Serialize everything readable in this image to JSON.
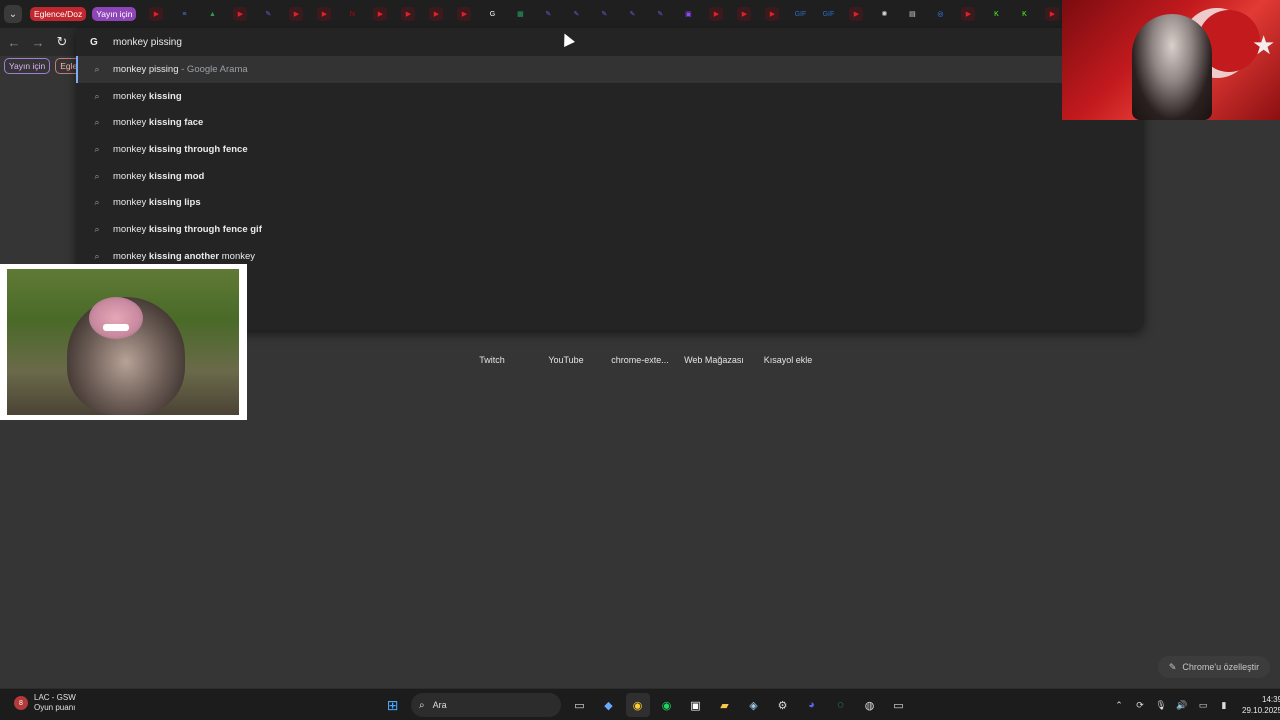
{
  "tabstrip": {
    "menu_icon": "chevron-down-icon",
    "groups": [
      {
        "label": "Eglence/Doz",
        "color": "#c2262e"
      },
      {
        "label": "Yayın için",
        "color": "#8e45b8"
      }
    ],
    "favicons": [
      {
        "icon": "youtube-icon",
        "color": "#e0202a"
      },
      {
        "icon": "docs-icon",
        "color": "#4a7ee0"
      },
      {
        "icon": "drive-icon",
        "color": "#2f9f4e"
      },
      {
        "icon": "youtube-icon",
        "color": "#e0202a"
      },
      {
        "icon": "quill-icon",
        "color": "#6b5bd6"
      },
      {
        "icon": "youtube-icon",
        "color": "#e0202a"
      },
      {
        "icon": "youtube-icon",
        "color": "#e0202a"
      },
      {
        "icon": "netflix-icon",
        "color": "#b00710"
      },
      {
        "icon": "youtube-icon",
        "color": "#e0202a"
      },
      {
        "icon": "youtube-icon",
        "color": "#e0202a"
      },
      {
        "icon": "youtube-icon",
        "color": "#e0202a"
      },
      {
        "icon": "youtube-icon",
        "color": "#e0202a"
      },
      {
        "icon": "google-icon",
        "color": "#ffffff"
      },
      {
        "icon": "sheets-icon",
        "color": "#20a463"
      },
      {
        "icon": "quill-icon",
        "color": "#6b5bd6"
      },
      {
        "icon": "quill-icon",
        "color": "#6b5bd6"
      },
      {
        "icon": "quill-icon",
        "color": "#6b5bd6"
      },
      {
        "icon": "quill-icon",
        "color": "#6b5bd6"
      },
      {
        "icon": "quill-icon",
        "color": "#6b5bd6"
      },
      {
        "icon": "twitch-icon",
        "color": "#9146ff"
      },
      {
        "icon": "youtube-icon",
        "color": "#e0202a"
      },
      {
        "icon": "youtube-icon",
        "color": "#e0202a"
      },
      {
        "icon": "youtube-icon",
        "color": "#e0202a"
      },
      {
        "icon": "gif-icon",
        "color": "#2a6cc4"
      },
      {
        "icon": "gif-icon",
        "color": "#2a6cc4"
      },
      {
        "icon": "youtube-icon",
        "color": "#e0202a"
      },
      {
        "icon": "chatgpt-icon",
        "color": "#dddddd"
      },
      {
        "icon": "page-icon",
        "color": "#dddddd"
      },
      {
        "icon": "globe-icon",
        "color": "#2a8cff"
      },
      {
        "icon": "youtube-icon",
        "color": "#e0202a"
      },
      {
        "icon": "kick-icon",
        "color": "#53fc18"
      },
      {
        "icon": "kick-icon",
        "color": "#53fc18"
      },
      {
        "icon": "youtube-icon",
        "color": "#e0202a"
      },
      {
        "icon": "youtube-icon",
        "color": "#e0202a"
      }
    ]
  },
  "toolbar": {
    "back_icon": "back-arrow-icon",
    "forward_icon": "forward-arrow-icon",
    "reload_icon": "reload-icon"
  },
  "bookmarks": {
    "chips": [
      {
        "label": "Yayın için"
      },
      {
        "label": "Eglen"
      }
    ]
  },
  "omnibox": {
    "query": "monkey pissing",
    "suggestions": [
      {
        "prefix": "monkey pissing",
        "bold": "",
        "suffix": "",
        "sub": " - Google Arama",
        "selected": true
      },
      {
        "prefix": "monkey ",
        "bold": "kissing",
        "suffix": "",
        "sub": "",
        "selected": false
      },
      {
        "prefix": "monkey ",
        "bold": "kissing face",
        "suffix": "",
        "sub": "",
        "selected": false
      },
      {
        "prefix": "monkey ",
        "bold": "kissing through fence",
        "suffix": "",
        "sub": "",
        "selected": false
      },
      {
        "prefix": "monkey ",
        "bold": "kissing mod",
        "suffix": "",
        "sub": "",
        "selected": false
      },
      {
        "prefix": "monkey ",
        "bold": "kissing lips",
        "suffix": "",
        "sub": "",
        "selected": false
      },
      {
        "prefix": "monkey ",
        "bold": "kissing through fence gif",
        "suffix": "",
        "sub": "",
        "selected": false
      },
      {
        "prefix": "monkey ",
        "bold": "kissing another",
        "suffix": " monkey",
        "sub": "",
        "selected": false
      }
    ]
  },
  "shortcuts": [
    {
      "label": "Twitch",
      "color": "#9146ff"
    },
    {
      "label": "YouTube",
      "color": "#e0202a"
    },
    {
      "label": "chrome-exte...",
      "color": "#5fa0d6"
    },
    {
      "label": "Web Mağazası",
      "color": "#5b8bd6"
    },
    {
      "label": "Kısayol ekle",
      "color": "#cccccc"
    }
  ],
  "customize": {
    "label": "Chrome'u özelleştir",
    "icon": "pencil-icon"
  },
  "taskbar": {
    "widget": {
      "badge": "8",
      "title": "LAC - GSW",
      "subtitle": "Oyun puanı"
    },
    "search_placeholder": "Ara",
    "apps": [
      {
        "icon": "task-view-icon",
        "color": "#dddddd"
      },
      {
        "icon": "copilot-icon",
        "color": "#6aa8ff"
      },
      {
        "icon": "chrome-icon",
        "color": "#ffcc33",
        "active": true
      },
      {
        "icon": "spotify-icon",
        "color": "#1ed760"
      },
      {
        "icon": "app-icon",
        "color": "#ffffff"
      },
      {
        "icon": "file-explorer-icon",
        "color": "#f7c948"
      },
      {
        "icon": "steam-icon",
        "color": "#9ec7e6"
      },
      {
        "icon": "settings-icon",
        "color": "#dddddd"
      },
      {
        "icon": "discord-icon",
        "color": "#5865f2"
      },
      {
        "icon": "whatsapp-icon",
        "color": "#25d366"
      },
      {
        "icon": "obs-icon",
        "color": "#dddddd"
      },
      {
        "icon": "terminal-icon",
        "color": "#dddddd"
      }
    ],
    "tray_icons": [
      "chevron-up-icon",
      "refresh-icon",
      "mic-icon",
      "speaker-icon",
      "display-icon",
      "battery-icon"
    ],
    "time": "14:39",
    "date": "29.10.2025"
  }
}
